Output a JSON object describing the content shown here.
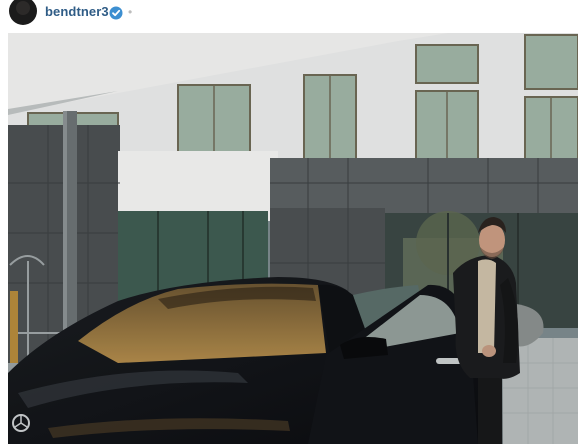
{
  "header": {
    "username": "bendtner3",
    "verified_icon": "verified-badge-icon",
    "separator": "•"
  },
  "photo": {
    "subject": "photo-man-with-black-car"
  },
  "colors": {
    "username": "#2f5c86",
    "verified_badge": "#3d8fd1"
  }
}
